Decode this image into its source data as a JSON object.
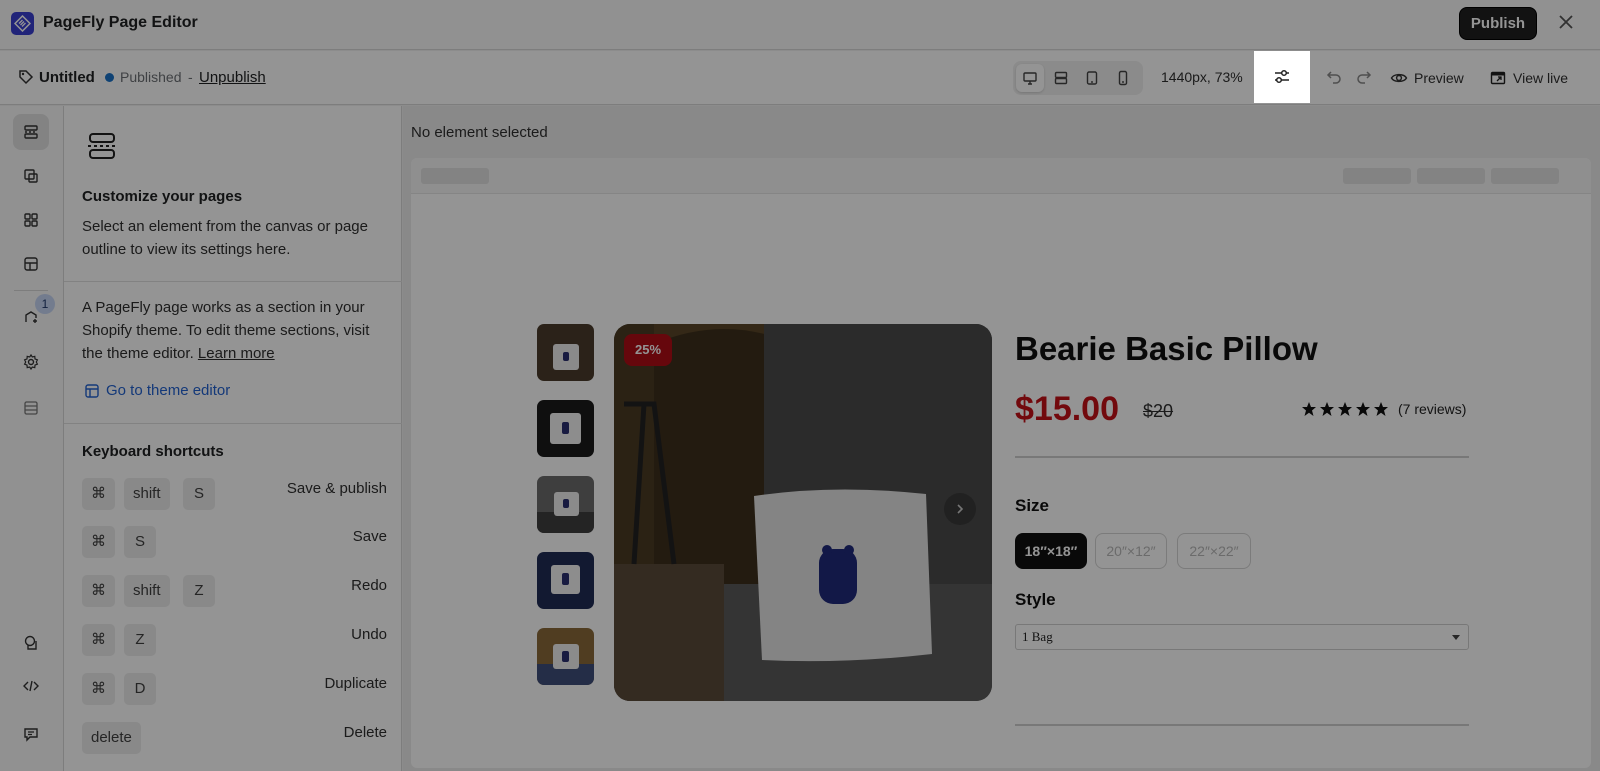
{
  "app": {
    "title": "PageFly Page Editor",
    "publish_label": "Publish"
  },
  "toolbar": {
    "page_name": "Untitled",
    "status": "Published",
    "separator": "-",
    "unpublish_label": "Unpublish",
    "zoom": "1440px, 73%",
    "preview_label": "Preview",
    "view_live_label": "View live"
  },
  "rail": {
    "badge_count": "1"
  },
  "panel": {
    "title": "Customize your pages",
    "desc": "Select an element from the canvas or page outline to view its settings here.",
    "section_text": "A PageFly page works as a section in your Shopify theme. To edit theme sections, visit the theme editor.",
    "learn_more": "Learn more",
    "theme_editor_link": "Go to theme editor",
    "shortcuts_title": "Keyboard shortcuts",
    "shortcuts": [
      {
        "keys": [
          "⌘",
          "shift",
          "S"
        ],
        "label": "Save & publish"
      },
      {
        "keys": [
          "⌘",
          "S"
        ],
        "label": "Save"
      },
      {
        "keys": [
          "⌘",
          "shift",
          "Z"
        ],
        "label": "Redo"
      },
      {
        "keys": [
          "⌘",
          "Z"
        ],
        "label": "Undo"
      },
      {
        "keys": [
          "⌘",
          "D"
        ],
        "label": "Duplicate"
      },
      {
        "keys": [
          "delete"
        ],
        "label": "Delete"
      }
    ]
  },
  "canvas": {
    "no_selection": "No element selected",
    "product": {
      "discount_badge": "25%",
      "title": "Bearie Basic Pillow",
      "price": "$15.00",
      "compare_price": "$20",
      "rating": 5,
      "review_count": "(7 reviews)",
      "size_label": "Size",
      "sizes": [
        "18″×18″",
        "20″×12″",
        "22″×22″"
      ],
      "style_label": "Style",
      "style_value": "1 Bag"
    }
  },
  "colors": {
    "accent": "#3a3fd0",
    "price": "#c41017",
    "badge": "#b00d16",
    "link": "#2463d1"
  }
}
